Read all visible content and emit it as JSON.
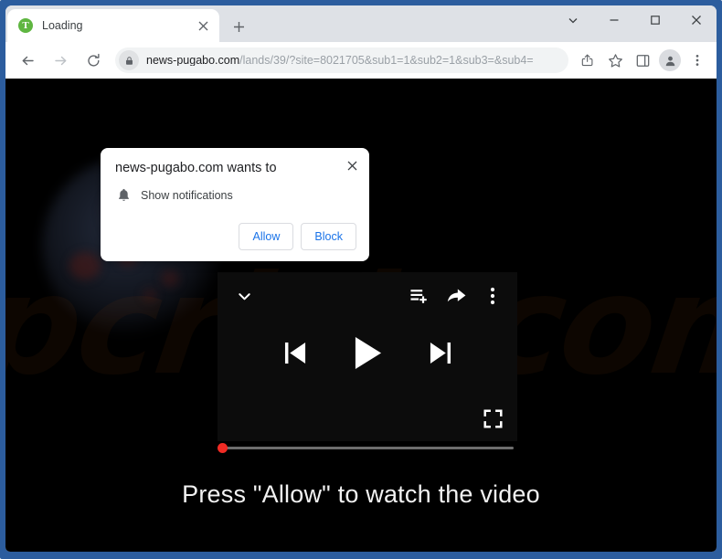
{
  "window": {
    "controls": {
      "chevron_label": "Search tabs",
      "minimize_label": "Minimize",
      "maximize_label": "Maximize",
      "close_label": "Close"
    }
  },
  "tabs": [
    {
      "title": "Loading",
      "favicon_letter": "T",
      "favicon_color": "#5fb641",
      "close_label": "×"
    }
  ],
  "new_tab": {
    "label": "+"
  },
  "toolbar": {
    "back_label": "←",
    "forward_label": "→",
    "reload_label": "⟳",
    "url_host": "news-pugabo.com",
    "url_path": "/lands/39/?site=8021705&sub1=1&sub2=1&sub3=&sub4=",
    "url_full": "news-pugabo.com/lands/39/?site=8021705&sub1=1&sub2=1&sub3=&sub4=",
    "share_label": "Share this page",
    "bookmark_label": "Bookmark this tab",
    "side_panel_label": "Side panel",
    "profile_label": "Profile",
    "menu_label": "Customize and control Google Chrome"
  },
  "permission_popup": {
    "title": "news-pugabo.com wants to",
    "permission_icon": "bell-icon",
    "permission_label": "Show notifications",
    "allow_label": "Allow",
    "block_label": "Block",
    "close_label": "×"
  },
  "page": {
    "background_color": "#000000",
    "watermark_text": "pcrisk.com",
    "headline": "Press \"Allow\" to watch the video",
    "video_player": {
      "collapse_icon": "chevron-down-icon",
      "add_to_queue_icon": "add-to-queue-icon",
      "share_icon": "share-arrow-icon",
      "more_icon": "three-dots-vertical-icon",
      "previous_icon": "previous-track-icon",
      "play_icon": "play-icon",
      "next_icon": "next-track-icon",
      "fullscreen_icon": "fullscreen-icon",
      "progress_percent": 0,
      "progress_thumb_color": "#f12b24"
    }
  }
}
